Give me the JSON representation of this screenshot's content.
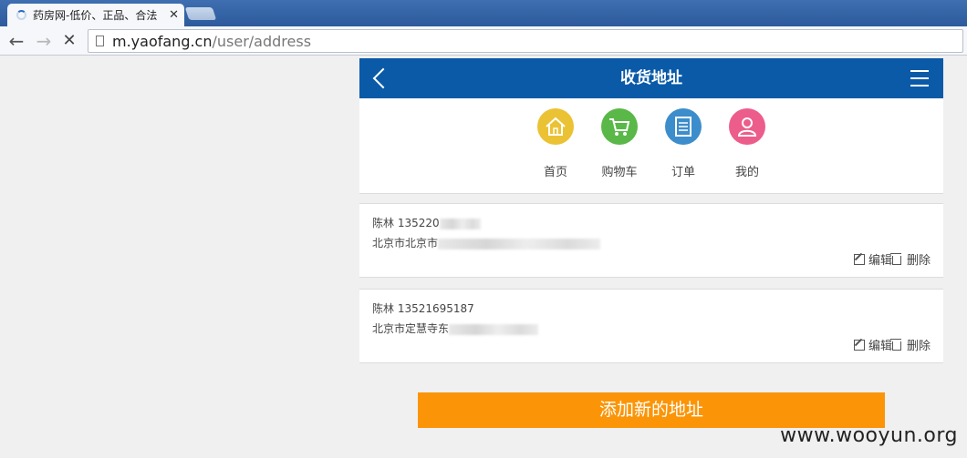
{
  "browser": {
    "tab_title": "药房网-低价、正品、合法",
    "tab_close": "✕",
    "url_host": "m.yaofang.cn",
    "url_path": "/user/address"
  },
  "header": {
    "title": "收货地址"
  },
  "quicknav": [
    {
      "label": "首页",
      "icon": "home-icon",
      "color": "#ebc233"
    },
    {
      "label": "购物车",
      "icon": "cart-icon",
      "color": "#5ab848"
    },
    {
      "label": "订单",
      "icon": "document-icon",
      "color": "#3c8dcb"
    },
    {
      "label": "我的",
      "icon": "user-icon",
      "color": "#ec5d8c"
    }
  ],
  "addresses": [
    {
      "name_phone": "陈林 135220",
      "address": "北京市北京市"
    },
    {
      "name_phone": "陈林 13521695187",
      "address": "北京市定慧寺东"
    }
  ],
  "actions": {
    "edit": "编辑",
    "delete": "删除"
  },
  "add_button": "添加新的地址",
  "watermark": "www.wooyun.org",
  "colors": {
    "header": "#0a5aa8",
    "add_button": "#fb9507"
  }
}
